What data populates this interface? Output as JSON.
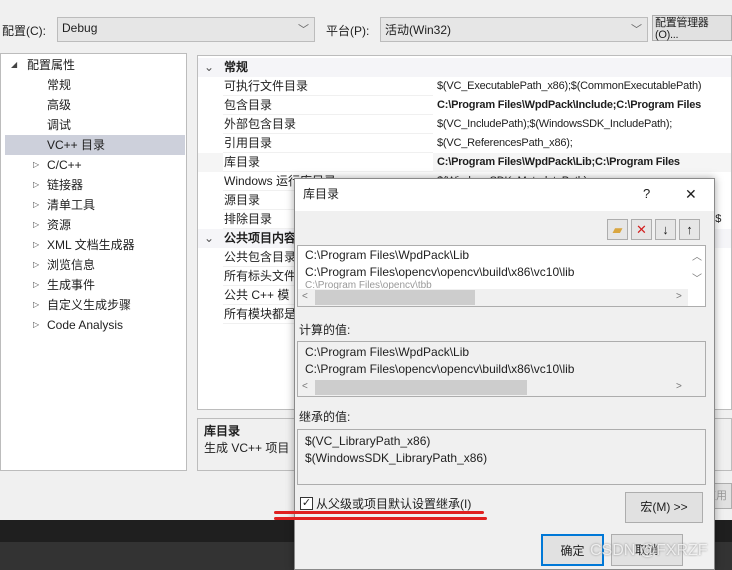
{
  "toolbar": {
    "config_label": "配置(C):",
    "config_value": "Debug",
    "platform_label": "平台(P):",
    "platform_value": "活动(Win32)",
    "config_manager": "配置管理器(O)..."
  },
  "tree": {
    "root": "配置属性",
    "items": [
      "常规",
      "高级",
      "调试",
      "VC++ 目录"
    ],
    "groups": [
      "C/C++",
      "链接器",
      "清单工具",
      "资源",
      "XML 文档生成器",
      "浏览信息",
      "生成事件",
      "自定义生成步骤",
      "Code Analysis"
    ],
    "selected": "VC++ 目录"
  },
  "grid": {
    "section1": "常规",
    "rows1": [
      {
        "name": "可执行文件目录",
        "value": "$(VC_ExecutablePath_x86);$(CommonExecutablePath)",
        "bold": false
      },
      {
        "name": "包含目录",
        "value": "C:\\Program Files\\WpdPack\\Include;C:\\Program Files",
        "bold": true
      },
      {
        "name": "外部包含目录",
        "value": "$(VC_IncludePath);$(WindowsSDK_IncludePath);",
        "bold": false
      },
      {
        "name": "引用目录",
        "value": "$(VC_ReferencesPath_x86);",
        "bold": false
      },
      {
        "name": "库目录",
        "value": "C:\\Program Files\\WpdPack\\Lib;C:\\Program Files",
        "bold": true
      },
      {
        "name": "Windows 运行库目录",
        "value": "$(WindowsSDK_MetadataPath);",
        "bold": false
      },
      {
        "name": "源目录",
        "value": "",
        "bold": false
      },
      {
        "name": "排除目录",
        "value": "6);$",
        "bold": false
      }
    ],
    "section2": "公共项目内容",
    "rows2": [
      "公共包含目录",
      "所有标头文件",
      "公共 C++ 模",
      "所有模块都是"
    ]
  },
  "description": {
    "title": "库目录",
    "text": "生成 VC++ 项目"
  },
  "apply": "应用",
  "dialog": {
    "title": "库目录",
    "help": "?",
    "close": "✕",
    "tools": [
      "new-folder",
      "delete",
      "move-down",
      "move-up"
    ],
    "entries": [
      "C:\\Program Files\\WpdPack\\Lib",
      "C:\\Program Files\\opencv\\opencv\\build\\x86\\vc10\\lib",
      "C:\\Program Files\\opencv\\tbb"
    ],
    "computed_label": "计算的值:",
    "computed": [
      "C:\\Program Files\\WpdPack\\Lib",
      "C:\\Program Files\\opencv\\opencv\\build\\x86\\vc10\\lib"
    ],
    "inherited_label": "继承的值:",
    "inherited": [
      "$(VC_LibraryPath_x86)",
      "$(WindowsSDK_LibraryPath_x86)"
    ],
    "inherit_checkbox": "从父级或项目默认设置继承(I)",
    "inherit_checked": true,
    "macros": "宏(M) >>",
    "ok": "确定",
    "cancel": "取消"
  },
  "watermark": "CSDN @FXRZF",
  "colors": {
    "annotation": "#e02020",
    "focus": "#0078d7"
  }
}
